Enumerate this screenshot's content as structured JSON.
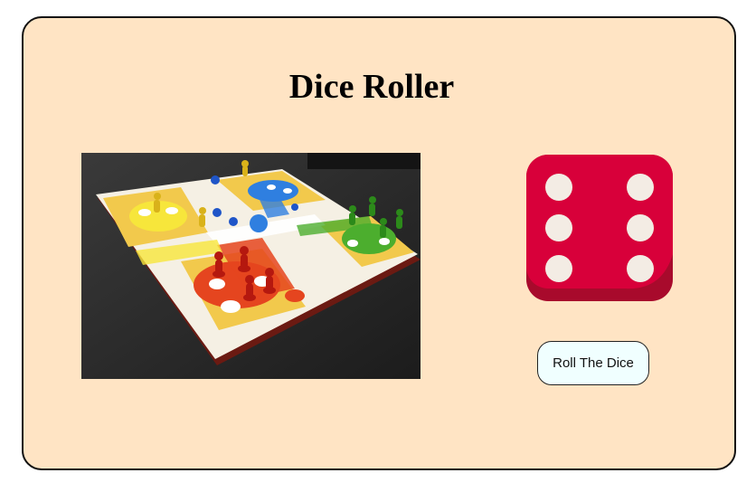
{
  "page": {
    "title": "Dice Roller"
  },
  "board_image": {
    "icon": "ludo-board-photo"
  },
  "die": {
    "icon": "dice-six-icon",
    "face_value": 6,
    "color": "#d8003a",
    "pip_color": "#f3ece4"
  },
  "roll_button": {
    "label": "Roll The Dice"
  },
  "colors": {
    "background": "#ffe4c4",
    "button_background": "#f0ffff"
  }
}
